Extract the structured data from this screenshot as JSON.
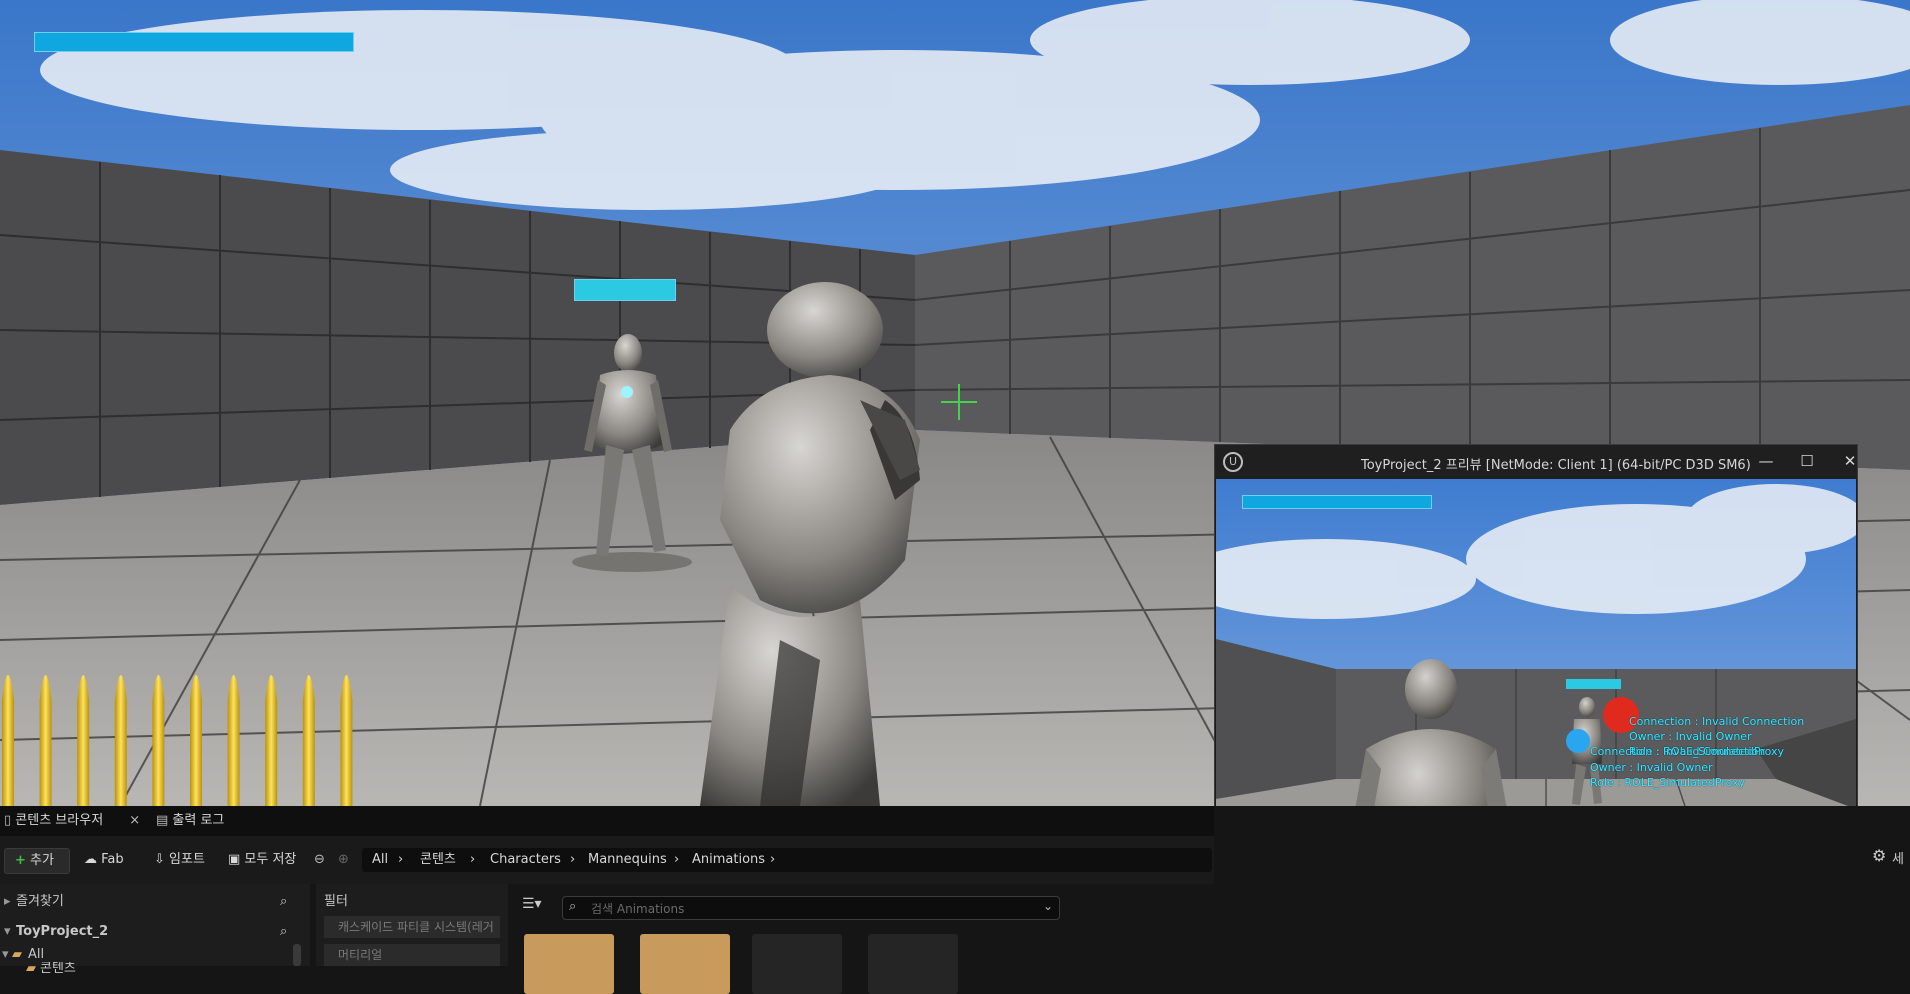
{
  "viewport": {
    "crosshair_color": "#45d14e",
    "health_bar_color": "#0ea7df",
    "ammo_count": 10,
    "ammo_color": "#e8c21d"
  },
  "preview_window": {
    "title": "ToyProject_2 프리뷰 [NetMode: Client 1]  (64-bit/PC D3D SM6)",
    "minimize_glyph": "—",
    "maximize_glyph": "☐",
    "close_glyph": "✕",
    "debug_lines": [
      "Connection : Invalid Connection",
      "Owner : Invalid Owner",
      "Role : ROLE_SimulatedProxy",
      "Connection : Invalid Connection",
      "Owner : Invalid Owner",
      "Role : ROLE_SimulatedProxy"
    ],
    "debug_color": "#2ef0ff"
  },
  "content_browser": {
    "tabs": [
      {
        "label": "콘텐츠 브라우저",
        "close": "×"
      },
      {
        "label": "출력 로그"
      }
    ],
    "toolbar": {
      "add_label": "추가",
      "fab_label": "Fab",
      "import_label": "임포트",
      "save_all_label": "모두 저장"
    },
    "breadcrumb": [
      "All",
      "콘텐츠",
      "Characters",
      "Mannequins",
      "Animations"
    ],
    "sidebar": {
      "favorites_label": "즐겨찾기",
      "project_label": "ToyProject_2",
      "all_label": "All",
      "content_label": "콘텐츠"
    },
    "filters": {
      "header": "필터",
      "items": [
        "캐스케이드 파티클 시스템(레거",
        "머티리얼"
      ]
    },
    "search_placeholder": "검색 Animations",
    "settings_label": "세"
  }
}
